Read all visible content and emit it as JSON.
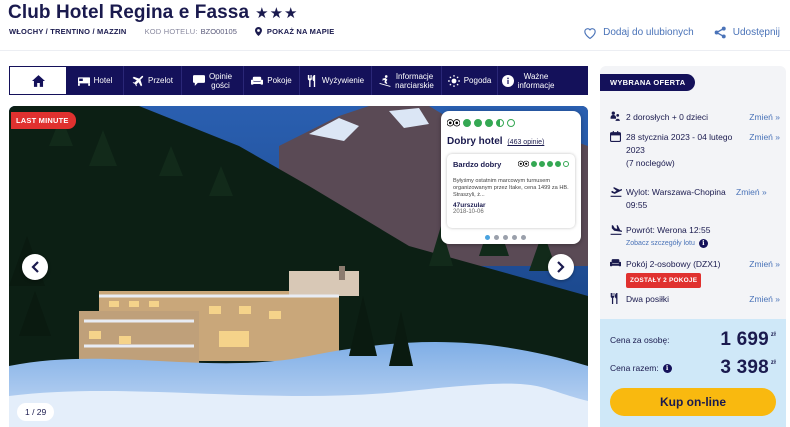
{
  "header": {
    "title": "Club Hotel Regina e Fassa",
    "stars": "★★★",
    "location": "WŁOCHY / TRENTINO / MAZZIN",
    "code_label": "KOD HOTELU:",
    "code": "BZO00105",
    "map_label": "POKAŻ NA MAPIE",
    "favorite_label": "Dodaj do ulubionych",
    "share_label": "Udostępnij"
  },
  "nav": {
    "tabs": [
      {
        "label": "Hotel",
        "icon": "bed-icon"
      },
      {
        "label": "Przelot",
        "icon": "plane-icon"
      },
      {
        "label": "Opinie\ngości",
        "icon": "chat-icon"
      },
      {
        "label": "Pokoje",
        "icon": "sofa-icon"
      },
      {
        "label": "Wyżywienie",
        "icon": "fork-knife-icon"
      },
      {
        "label": "Informacje\nnarciarskie",
        "icon": "skier-icon"
      },
      {
        "label": "Pogoda",
        "icon": "sun-icon"
      },
      {
        "label": "Ważne\ninformacje",
        "icon": "info-icon"
      }
    ]
  },
  "gallery": {
    "badge": "LAST MINUTE",
    "counter": "1 / 29"
  },
  "review": {
    "overall_label": "Dobry hotel",
    "opinions_count": "(463 opinie)",
    "overall_bubbles": 3.5,
    "item_title": "Bardzo dobry",
    "item_bubbles": 4,
    "item_text": "Byłyśmy ostatnim marcowym turnusem organizowanym przez Itake, cena 1499 za HB. Straszyli, ż...",
    "item_user": "47urszular",
    "item_date": "2018-10-06"
  },
  "offer": {
    "tab_label": "WYBRANA OFERTA",
    "change_label": "Zmień",
    "guests": "2 dorosłych + 0 dzieci",
    "dates": "28 stycznia 2023 - 04 lutego 2023",
    "nights": "(7 noclegów)",
    "departure": "Wylot: Warszawa-Chopina 09:55",
    "return": "Powrót: Werona 12:55",
    "flight_details": "Zobacz szczegóły lotu",
    "room": "Pokój 2-osobowy (DZX1)",
    "rooms_left": "ZOSTAŁY 2 POKOJE",
    "board": "Dwa posiłki",
    "price_per_person_label": "Cena za osobę:",
    "price_per_person": "1 699",
    "price_total_label": "Cena razem:",
    "price_total": "3 398",
    "currency": "zł",
    "buy_label": "Kup on-line"
  },
  "colors": {
    "navy": "#14115a",
    "accent_blue": "#4a73b8",
    "badge_red": "#e0312f",
    "buy_yellow": "#f9b90f",
    "price_bg": "#cfe8f8",
    "tripadvisor_green": "#34a853"
  }
}
